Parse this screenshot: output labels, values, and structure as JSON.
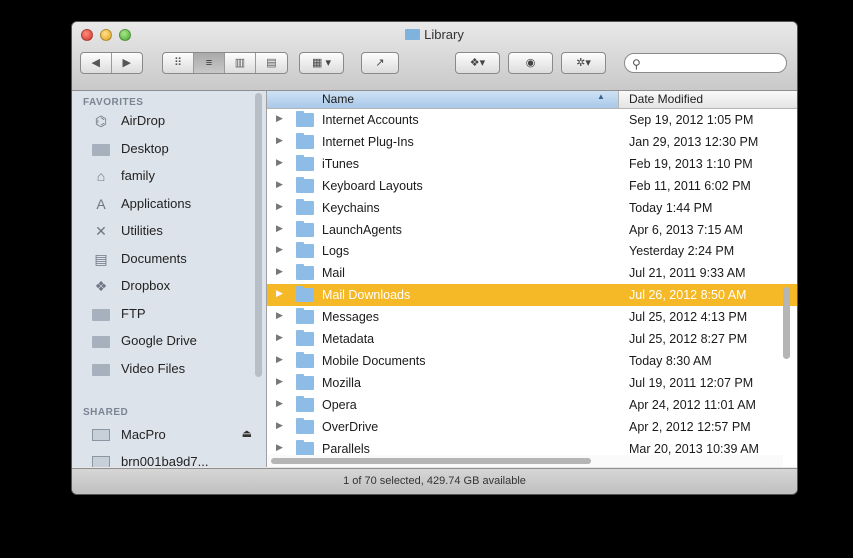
{
  "window": {
    "title": "Library"
  },
  "toolbar": {
    "back_label": "◀",
    "forward_label": "▶",
    "view_icon": "⠿",
    "view_list": "≡",
    "view_columns": "▥",
    "view_coverflow": "▤",
    "arrange_label": "▦ ▾",
    "share_label": "↗",
    "dropbox_label": "❖▾",
    "quicklook_label": "◉",
    "action_label": "✲▾",
    "search_placeholder": ""
  },
  "sidebar": {
    "favorites_heading": "FAVORITES",
    "favorites": [
      {
        "label": "AirDrop",
        "icon": "airdrop-icon",
        "glyph": "⌬"
      },
      {
        "label": "Desktop",
        "icon": "desktop-icon",
        "glyph": ""
      },
      {
        "label": "family",
        "icon": "home-icon",
        "glyph": "⌂"
      },
      {
        "label": "Applications",
        "icon": "applications-icon",
        "glyph": "A"
      },
      {
        "label": "Utilities",
        "icon": "utilities-icon",
        "glyph": "✕"
      },
      {
        "label": "Documents",
        "icon": "documents-icon",
        "glyph": "▤"
      },
      {
        "label": "Dropbox",
        "icon": "dropbox-icon",
        "glyph": "❖"
      },
      {
        "label": "FTP",
        "icon": "folder-icon",
        "glyph": ""
      },
      {
        "label": "Google Drive",
        "icon": "folder-icon",
        "glyph": ""
      },
      {
        "label": "Video Files",
        "icon": "folder-icon",
        "glyph": ""
      }
    ],
    "shared_heading": "SHARED",
    "shared": [
      {
        "label": "MacPro",
        "icon": "computer-icon",
        "eject": "⏏"
      },
      {
        "label": "brn001ba9d7...",
        "icon": "printer-icon",
        "eject": ""
      }
    ]
  },
  "filelist": {
    "columns": {
      "name": "Name",
      "date": "Date Modified"
    },
    "rows": [
      {
        "name": "Internet Accounts",
        "date": "Sep 19, 2012 1:05 PM",
        "selected": false
      },
      {
        "name": "Internet Plug-Ins",
        "date": "Jan 29, 2013 12:30 PM",
        "selected": false
      },
      {
        "name": "iTunes",
        "date": "Feb 19, 2013 1:10 PM",
        "selected": false
      },
      {
        "name": "Keyboard Layouts",
        "date": "Feb 11, 2011 6:02 PM",
        "selected": false
      },
      {
        "name": "Keychains",
        "date": "Today 1:44 PM",
        "selected": false
      },
      {
        "name": "LaunchAgents",
        "date": "Apr 6, 2013 7:15 AM",
        "selected": false
      },
      {
        "name": "Logs",
        "date": "Yesterday 2:24 PM",
        "selected": false
      },
      {
        "name": "Mail",
        "date": "Jul 21, 2011 9:33 AM",
        "selected": false
      },
      {
        "name": "Mail Downloads",
        "date": "Jul 26, 2012 8:50 AM",
        "selected": true
      },
      {
        "name": "Messages",
        "date": "Jul 25, 2012 4:13 PM",
        "selected": false
      },
      {
        "name": "Metadata",
        "date": "Jul 25, 2012 8:27 PM",
        "selected": false
      },
      {
        "name": "Mobile Documents",
        "date": "Today 8:30 AM",
        "selected": false
      },
      {
        "name": "Mozilla",
        "date": "Jul 19, 2011 12:07 PM",
        "selected": false
      },
      {
        "name": "Opera",
        "date": "Apr 24, 2012 11:01 AM",
        "selected": false
      },
      {
        "name": "OverDrive",
        "date": "Apr 2, 2012 12:57 PM",
        "selected": false
      },
      {
        "name": "Parallels",
        "date": "Mar 20, 2013 10:39 AM",
        "selected": false
      }
    ]
  },
  "status": {
    "text": "1 of 70 selected, 429.74 GB available"
  },
  "colors": {
    "selection": "#f5b826",
    "sidebar_bg": "#dde3ea",
    "folder": "#8dbde6"
  }
}
